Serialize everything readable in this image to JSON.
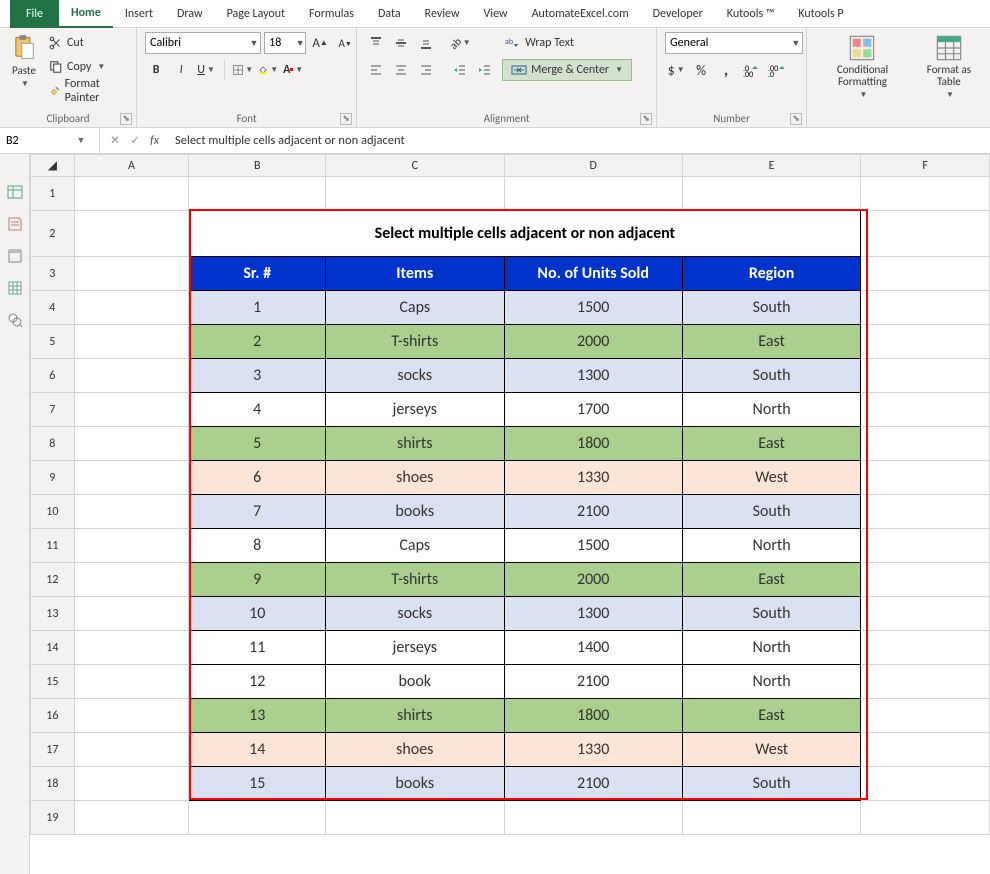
{
  "tabs": {
    "file": "File",
    "items": [
      "Home",
      "Insert",
      "Draw",
      "Page Layout",
      "Formulas",
      "Data",
      "Review",
      "View",
      "AutomateExcel.com",
      "Developer",
      "Kutools ™",
      "Kutools P"
    ],
    "active": "Home"
  },
  "ribbon": {
    "clipboard": {
      "paste": "Paste",
      "cut": "Cut",
      "copy": "Copy",
      "format_painter": "Format Painter",
      "name": "Clipboard"
    },
    "font": {
      "name_val": "Calibri",
      "size_val": "18",
      "name": "Font"
    },
    "alignment": {
      "wrap": "Wrap Text",
      "merge": "Merge & Center",
      "name": "Alignment"
    },
    "number": {
      "format": "General",
      "name": "Number"
    },
    "styles": {
      "cond": "Conditional Formatting",
      "fmt_table": "Format as Table"
    }
  },
  "formula_bar": {
    "cell_ref": "B2",
    "formula": "Select multiple cells adjacent or non adjacent"
  },
  "columns": [
    "A",
    "B",
    "C",
    "D",
    "E",
    "F"
  ],
  "row_numbers": [
    "1",
    "2",
    "3",
    "4",
    "5",
    "6",
    "7",
    "8",
    "9",
    "10",
    "11",
    "12",
    "13",
    "14",
    "15",
    "16",
    "17",
    "18",
    "19"
  ],
  "sheet": {
    "title": "Select multiple cells adjacent or non adjacent",
    "headers": [
      "Sr. #",
      "Items",
      "No. of Units Sold",
      "Region"
    ],
    "rows": [
      {
        "n": "1",
        "item": "Caps",
        "units": "1500",
        "region": "South",
        "cls": "bg-blue"
      },
      {
        "n": "2",
        "item": "T-shirts",
        "units": "2000",
        "region": "East",
        "cls": "bg-green"
      },
      {
        "n": "3",
        "item": "socks",
        "units": "1300",
        "region": "South",
        "cls": "bg-blue"
      },
      {
        "n": "4",
        "item": "jerseys",
        "units": "1700",
        "region": "North",
        "cls": "bg-white"
      },
      {
        "n": "5",
        "item": "shirts",
        "units": "1800",
        "region": "East",
        "cls": "bg-green"
      },
      {
        "n": "6",
        "item": "shoes",
        "units": "1330",
        "region": "West",
        "cls": "bg-peach"
      },
      {
        "n": "7",
        "item": "books",
        "units": "2100",
        "region": "South",
        "cls": "bg-blue"
      },
      {
        "n": "8",
        "item": "Caps",
        "units": "1500",
        "region": "North",
        "cls": "bg-white"
      },
      {
        "n": "9",
        "item": "T-shirts",
        "units": "2000",
        "region": "East",
        "cls": "bg-green"
      },
      {
        "n": "10",
        "item": "socks",
        "units": "1300",
        "region": "South",
        "cls": "bg-blue"
      },
      {
        "n": "11",
        "item": "jerseys",
        "units": "1400",
        "region": "North",
        "cls": "bg-white"
      },
      {
        "n": "12",
        "item": "book",
        "units": "2100",
        "region": "North",
        "cls": "bg-white"
      },
      {
        "n": "13",
        "item": "shirts",
        "units": "1800",
        "region": "East",
        "cls": "bg-green"
      },
      {
        "n": "14",
        "item": "shoes",
        "units": "1330",
        "region": "West",
        "cls": "bg-peach"
      },
      {
        "n": "15",
        "item": "books",
        "units": "2100",
        "region": "South",
        "cls": "bg-blue"
      }
    ]
  }
}
